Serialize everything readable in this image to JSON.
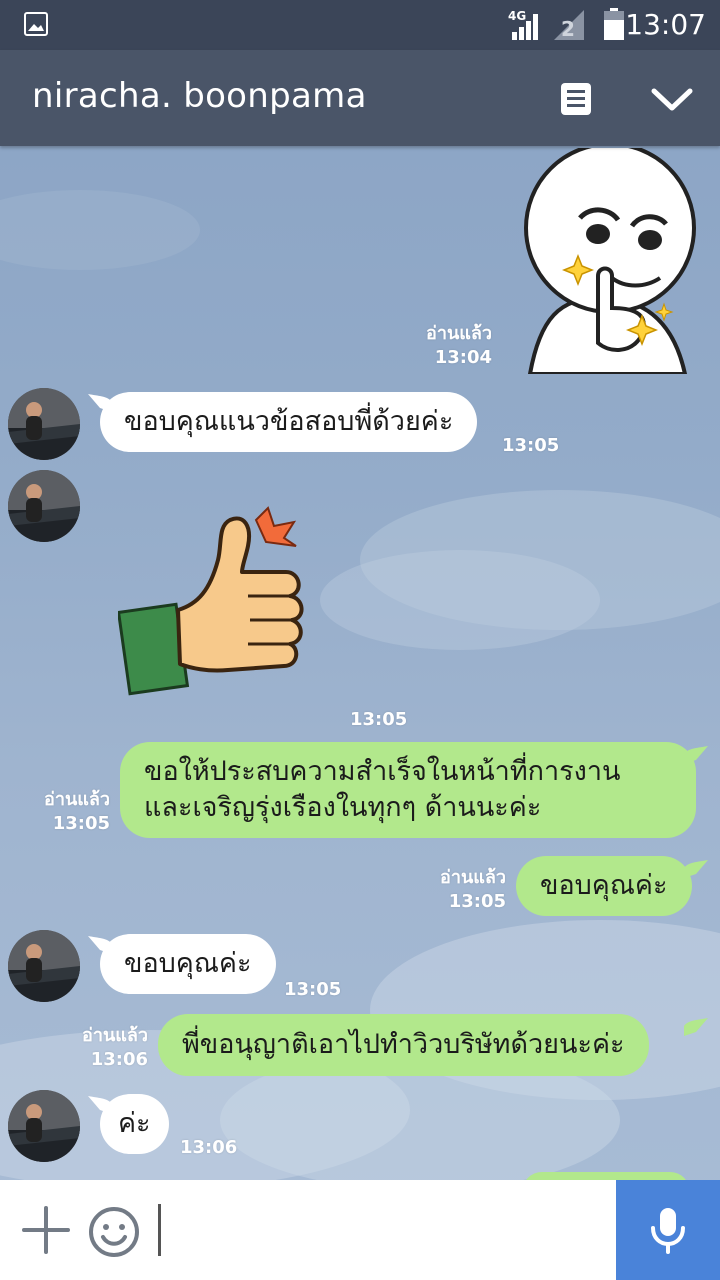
{
  "status_bar": {
    "time": "13:07",
    "network_label": "4G",
    "icons": [
      "image-icon",
      "signal-icon",
      "sim-signal-icon",
      "battery-icon"
    ]
  },
  "header": {
    "title": "niracha. boonpama",
    "icons": [
      "notes-icon",
      "chevron-down-icon"
    ]
  },
  "messages": [
    {
      "type": "sticker",
      "direction": "out",
      "sticker": "smug-face-thumbs-up",
      "read": "อ่านแล้ว",
      "time": "13:04"
    },
    {
      "type": "text",
      "direction": "in",
      "text": "ขอบคุณแนวข้อสอบพี่ด้วยค่ะ",
      "time": "13:05"
    },
    {
      "type": "sticker",
      "direction": "in",
      "sticker": "thumbs-up-hand",
      "time": "13:05"
    },
    {
      "type": "text",
      "direction": "out",
      "lines": [
        "ขอให้ประสบความสำเร็จในหน้าที่การงาน",
        "และเจริญรุ่งเรืองในทุกๆ ด้านนะค่ะ"
      ],
      "read": "อ่านแล้ว",
      "time": "13:05"
    },
    {
      "type": "text",
      "direction": "out",
      "text": "ขอบคุณค่ะ",
      "read": "อ่านแล้ว",
      "time": "13:05"
    },
    {
      "type": "text",
      "direction": "in",
      "text": "ขอบคุณค่ะ",
      "time": "13:05"
    },
    {
      "type": "text",
      "direction": "out",
      "text": "พี่ขอนุญาติเอาไปทำวิวบริษัทด้วยนะค่ะ",
      "read": "อ่านแล้ว",
      "time": "13:06"
    },
    {
      "type": "text",
      "direction": "in",
      "text": "ค่ะ",
      "time": "13:06"
    }
  ],
  "input_bar": {
    "icons": [
      "plus-icon",
      "emoji-icon",
      "microphone-icon"
    ],
    "accent_color": "#4a83d9"
  },
  "colors": {
    "header": "#4a5568",
    "status_bar": "#3b4558",
    "outgoing_bubble": "#b2e88c",
    "incoming_bubble": "#ffffff"
  }
}
